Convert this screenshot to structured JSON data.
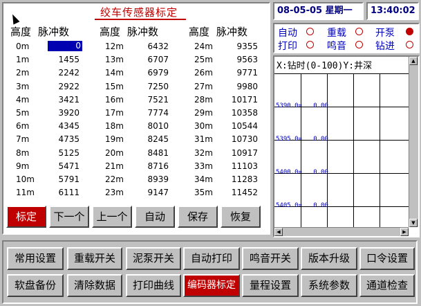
{
  "calibration": {
    "title": "绞车传感器标定",
    "header_height": "高度",
    "header_pulse": "脉冲数",
    "columns": [
      {
        "rows": [
          {
            "m": "0m",
            "v": "0"
          },
          {
            "m": "1m",
            "v": "1455"
          },
          {
            "m": "2m",
            "v": "2242"
          },
          {
            "m": "3m",
            "v": "2922"
          },
          {
            "m": "4m",
            "v": "3421"
          },
          {
            "m": "5m",
            "v": "3920"
          },
          {
            "m": "6m",
            "v": "4345"
          },
          {
            "m": "7m",
            "v": "4735"
          },
          {
            "m": "8m",
            "v": "5125"
          },
          {
            "m": "9m",
            "v": "5471"
          },
          {
            "m": "10m",
            "v": "5791"
          },
          {
            "m": "11m",
            "v": "6111"
          }
        ]
      },
      {
        "rows": [
          {
            "m": "12m",
            "v": "6432"
          },
          {
            "m": "13m",
            "v": "6707"
          },
          {
            "m": "14m",
            "v": "6979"
          },
          {
            "m": "15m",
            "v": "7250"
          },
          {
            "m": "16m",
            "v": "7521"
          },
          {
            "m": "17m",
            "v": "7774"
          },
          {
            "m": "18m",
            "v": "8010"
          },
          {
            "m": "19m",
            "v": "8245"
          },
          {
            "m": "20m",
            "v": "8481"
          },
          {
            "m": "21m",
            "v": "8716"
          },
          {
            "m": "22m",
            "v": "8939"
          },
          {
            "m": "23m",
            "v": "9147"
          }
        ]
      },
      {
        "rows": [
          {
            "m": "24m",
            "v": "9355"
          },
          {
            "m": "25m",
            "v": "9563"
          },
          {
            "m": "26m",
            "v": "9771"
          },
          {
            "m": "27m",
            "v": "9980"
          },
          {
            "m": "28m",
            "v": "10171"
          },
          {
            "m": "29m",
            "v": "10358"
          },
          {
            "m": "30m",
            "v": "10544"
          },
          {
            "m": "31m",
            "v": "10730"
          },
          {
            "m": "32m",
            "v": "10917"
          },
          {
            "m": "33m",
            "v": "11103"
          },
          {
            "m": "34m",
            "v": "11283"
          },
          {
            "m": "35m",
            "v": "11452"
          }
        ]
      }
    ],
    "buttons": {
      "calibrate": "标定",
      "next": "下一个",
      "prev": "上一个",
      "auto": "自动",
      "save": "保存",
      "restore": "恢复"
    }
  },
  "clock": {
    "date": "08-05-05 星期一",
    "time": "13:40:02"
  },
  "status": {
    "auto": "自动",
    "heavy": "重载",
    "pump": "开泵",
    "print": "打印",
    "beep": "鸣音",
    "drill": "钻进"
  },
  "plot": {
    "header": "X:钻时(0-100)Y:井深",
    "depths": [
      {
        "label": "5390.0=",
        "val": "0.00"
      },
      {
        "label": "5395.0=",
        "val": "0.00"
      },
      {
        "label": "5400.0=",
        "val": "0.00"
      },
      {
        "label": "5405.0=",
        "val": "0.00"
      }
    ]
  },
  "menu": {
    "row1": [
      "常用设置",
      "重载开关",
      "泥泵开关",
      "自动打印",
      "鸣音开关",
      "版本升级",
      "口令设置"
    ],
    "row2": [
      "软盘备份",
      "清除数据",
      "打印曲线",
      "编码器标定",
      "量程设置",
      "系统参数",
      "通道检查"
    ]
  },
  "colors": {
    "accent": "#c00000",
    "selection": "#0000b0",
    "status_text": "#0000c0"
  }
}
